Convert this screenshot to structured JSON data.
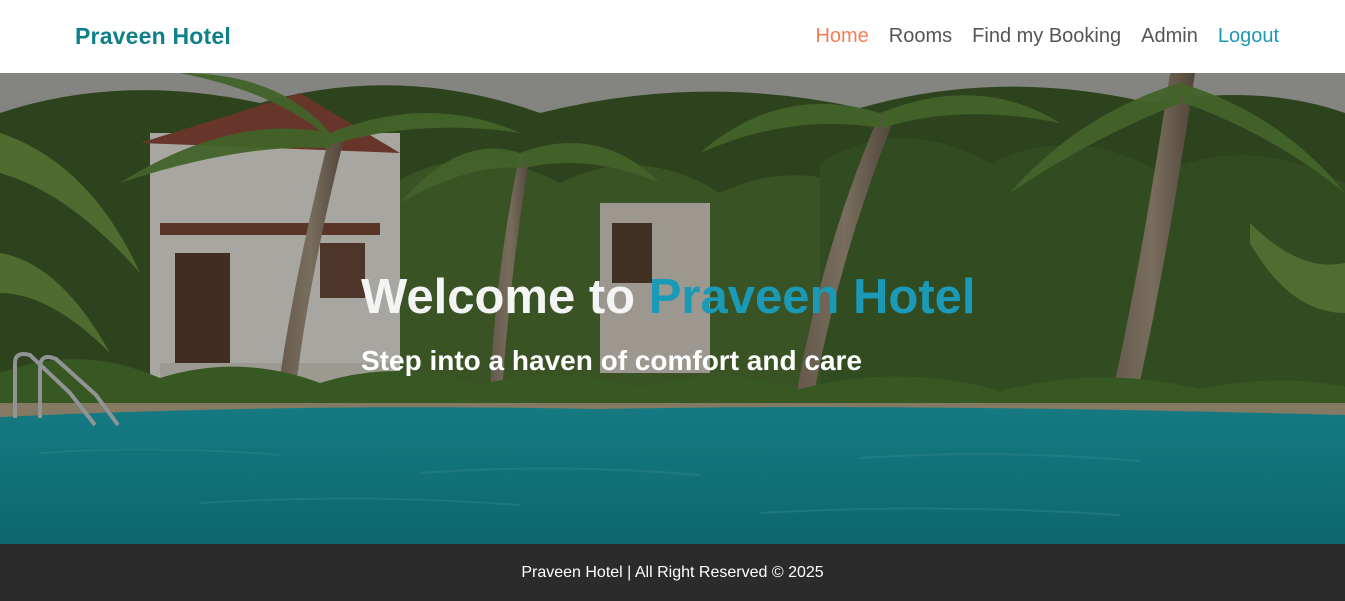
{
  "navbar": {
    "brand": "Praveen Hotel",
    "links": [
      {
        "label": "Home",
        "active": true
      },
      {
        "label": "Rooms"
      },
      {
        "label": "Find my Booking"
      },
      {
        "label": "Admin"
      },
      {
        "label": "Logout"
      }
    ]
  },
  "hero": {
    "title_prefix": "Welcome to",
    "title_accent": "Praveen Hotel",
    "subtitle": "Step into a haven of comfort and care",
    "background_image": "tropical-resort-pool-photo"
  },
  "footer": {
    "text": "Praveen Hotel | All Right Reserved © 2025"
  },
  "colors": {
    "brand": "#0f7f8a",
    "nav_active": "#f47f55",
    "nav_logout": "#1e98b8",
    "title_accent": "#1b9ab8",
    "footer_bg": "#2b2b2b"
  }
}
